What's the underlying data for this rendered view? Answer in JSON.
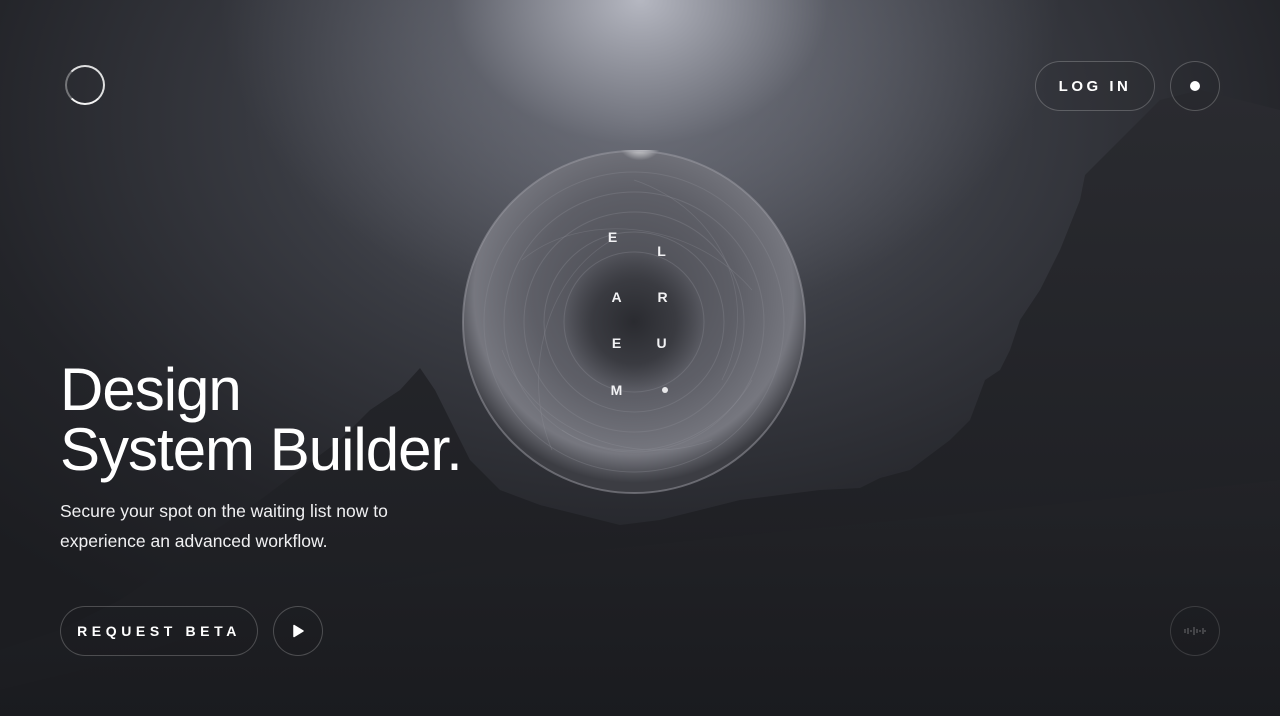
{
  "header": {
    "login_label": "LOG IN"
  },
  "hero": {
    "title_line1": "Design",
    "title_line2": "System Builder.",
    "subtitle_line1": "Secure your spot on the waiting list now to",
    "subtitle_line2": "experience an advanced workflow.",
    "request_label": "REQUEST BETA"
  },
  "orb": {
    "letters": [
      "E",
      "L",
      "A",
      "R",
      "E",
      "U",
      "M"
    ]
  },
  "icons": {
    "logo": "ring-logo-icon",
    "menu": "menu-dot-icon",
    "play": "play-icon",
    "audio": "sound-wave-icon"
  },
  "colors": {
    "background": "#1b1c20",
    "text": "#ffffff",
    "border": "rgba(255,255,255,0.22)"
  }
}
